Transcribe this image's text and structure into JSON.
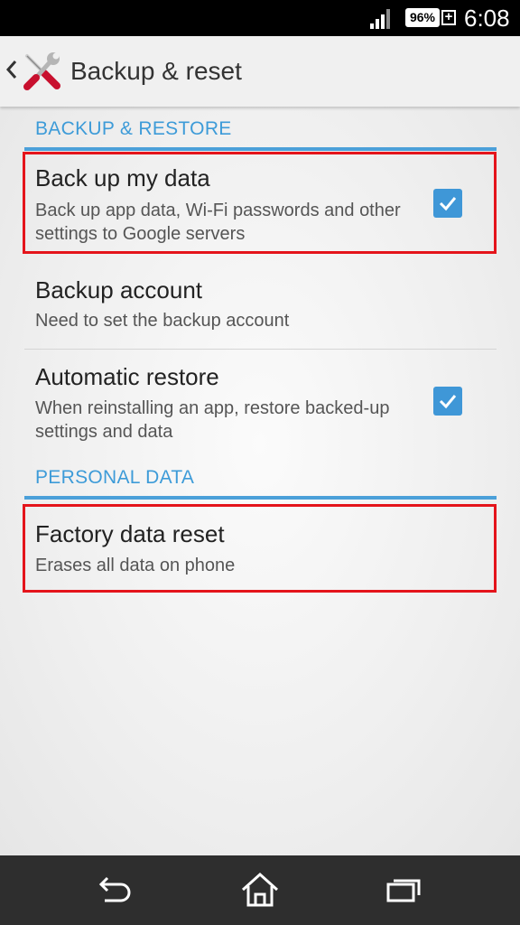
{
  "status_bar": {
    "battery_percent": "96%",
    "battery_plus": "+",
    "time": "6:08"
  },
  "action_bar": {
    "title": "Backup & reset"
  },
  "sections": [
    {
      "header": "BACKUP & RESTORE",
      "items": [
        {
          "title": "Back up my data",
          "summary": "Back up app data, Wi-Fi passwords and other settings to Google servers",
          "checked": true,
          "highlighted": true
        },
        {
          "title": "Backup account",
          "summary": "Need to set the backup account"
        },
        {
          "title": "Automatic restore",
          "summary": "When reinstalling an app, restore backed-up settings and data",
          "checked": true
        }
      ]
    },
    {
      "header": "PERSONAL DATA",
      "items": [
        {
          "title": "Factory data reset",
          "summary": "Erases all data on phone",
          "highlighted": true
        }
      ]
    }
  ],
  "colors": {
    "accent": "#3d9bd8",
    "highlight": "#e4141b",
    "nav_bar": "#2e2e2e",
    "status_bar": "#000000"
  },
  "icons": {
    "back": "chevron-left-icon",
    "app": "tools-icon",
    "nav_back": "back-arrow-icon",
    "nav_home": "home-icon",
    "nav_recents": "recent-apps-icon"
  }
}
